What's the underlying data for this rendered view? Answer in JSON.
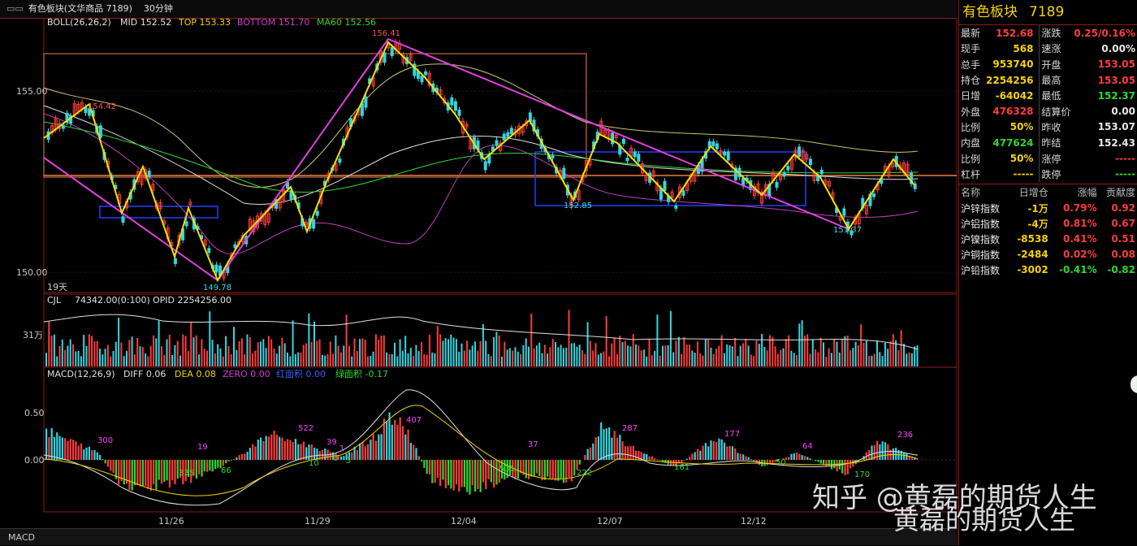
{
  "titlebar": {
    "name": "有色板块(文华商品 7189)",
    "timeframe": "30分钟"
  },
  "indicators": {
    "boll": {
      "label": "BOLL(26,26,2)",
      "mid": "MID 152.52",
      "top": "TOP 153.33",
      "bottom": "BOTTOM 151.70",
      "ma60": "MA60 152.56"
    },
    "vol": {
      "label": "CJL",
      "value": "74342.00(0:100)",
      "opid": "OPID 2254256.00"
    },
    "macd": {
      "label": "MACD(12,26,9)",
      "diff": "DIFF 0.06",
      "dea": "DEA 0.08",
      "zero": "ZERO 0.00",
      "red": "红面积 0.00",
      "green": "绿面积 -0.17"
    }
  },
  "price_axis": {
    "p155": "155.00",
    "p150": "150.00",
    "vol31": "31万",
    "m050": "0.50",
    "m000": "0.00"
  },
  "chart_labels": {
    "high": "156.41",
    "low": "149.78",
    "h1": "154.42",
    "l2": "152.85",
    "l3": "151.37",
    "days": "19天"
  },
  "macd_labels": [
    "300",
    "335",
    "19",
    "66",
    "522",
    "10",
    "39",
    "1",
    "0",
    "3",
    "407",
    "531",
    "37",
    "222",
    "287",
    "161",
    "177",
    "50",
    "64",
    "170",
    "236"
  ],
  "dates": [
    "11/26",
    "11/29",
    "12/04",
    "12/07",
    "12/12"
  ],
  "bottombar": {
    "label": "MACD"
  },
  "side": {
    "name": "有色板块",
    "code": "7189",
    "quote": [
      {
        "l": "最新",
        "v": "152.68",
        "vc": "r",
        "l2": "涨跌",
        "v2": "0.25/0.16%",
        "vc2": "r"
      },
      {
        "l": "现手",
        "v": "568",
        "vc": "y",
        "l2": "速涨",
        "v2": "0.00%",
        "vc2": "w"
      },
      {
        "l": "总手",
        "v": "953740",
        "vc": "y",
        "l2": "开盘",
        "v2": "153.05",
        "vc2": "r"
      },
      {
        "l": "持仓",
        "v": "2254256",
        "vc": "y",
        "l2": "最高",
        "v2": "153.05",
        "vc2": "r"
      },
      {
        "l": "日增",
        "v": "-64042",
        "vc": "y",
        "l2": "最低",
        "v2": "152.37",
        "vc2": "g"
      },
      {
        "l": "外盘",
        "v": "476328",
        "vc": "r",
        "l2": "结算价",
        "v2": "0.00",
        "vc2": "w"
      },
      {
        "l": "比例",
        "v": "50%",
        "vc": "y",
        "l2": "昨收",
        "v2": "153.07",
        "vc2": "w"
      },
      {
        "l": "内盘",
        "v": "477624",
        "vc": "g",
        "l2": "昨结",
        "v2": "152.43",
        "vc2": "w"
      },
      {
        "l": "比例",
        "v": "50%",
        "vc": "y",
        "l2": "涨停",
        "v2": "-----",
        "vc2": "r"
      },
      {
        "l": "杠杆",
        "v": "-----",
        "vc": "y",
        "l2": "跌停",
        "v2": "-----",
        "vc2": "g"
      }
    ],
    "index_headers": [
      "名称",
      "日增仓",
      "涨幅",
      "贡献度"
    ],
    "indexes": [
      {
        "n": "沪锌指数",
        "a": "-1万",
        "b": "0.79%",
        "c": "0.92",
        "cls": "r"
      },
      {
        "n": "沪铝指数",
        "a": "-4万",
        "b": "0.81%",
        "c": "0.67",
        "cls": "r"
      },
      {
        "n": "沪镍指数",
        "a": "-8538",
        "b": "0.41%",
        "c": "0.51",
        "cls": "r"
      },
      {
        "n": "沪铜指数",
        "a": "-2484",
        "b": "0.02%",
        "c": "0.08",
        "cls": "r"
      },
      {
        "n": "沪铅指数",
        "a": "-3002",
        "b": "-0.41%",
        "c": "-0.82",
        "cls": "g"
      }
    ]
  },
  "watermark": {
    "line1": "知乎 @黄磊的期货人生",
    "line2": "黄磊的期货人生"
  },
  "colors": {
    "accent": "#f5d300",
    "up": "#ff3c3c",
    "down": "#2fd82f",
    "border": "#8b1a1a"
  }
}
